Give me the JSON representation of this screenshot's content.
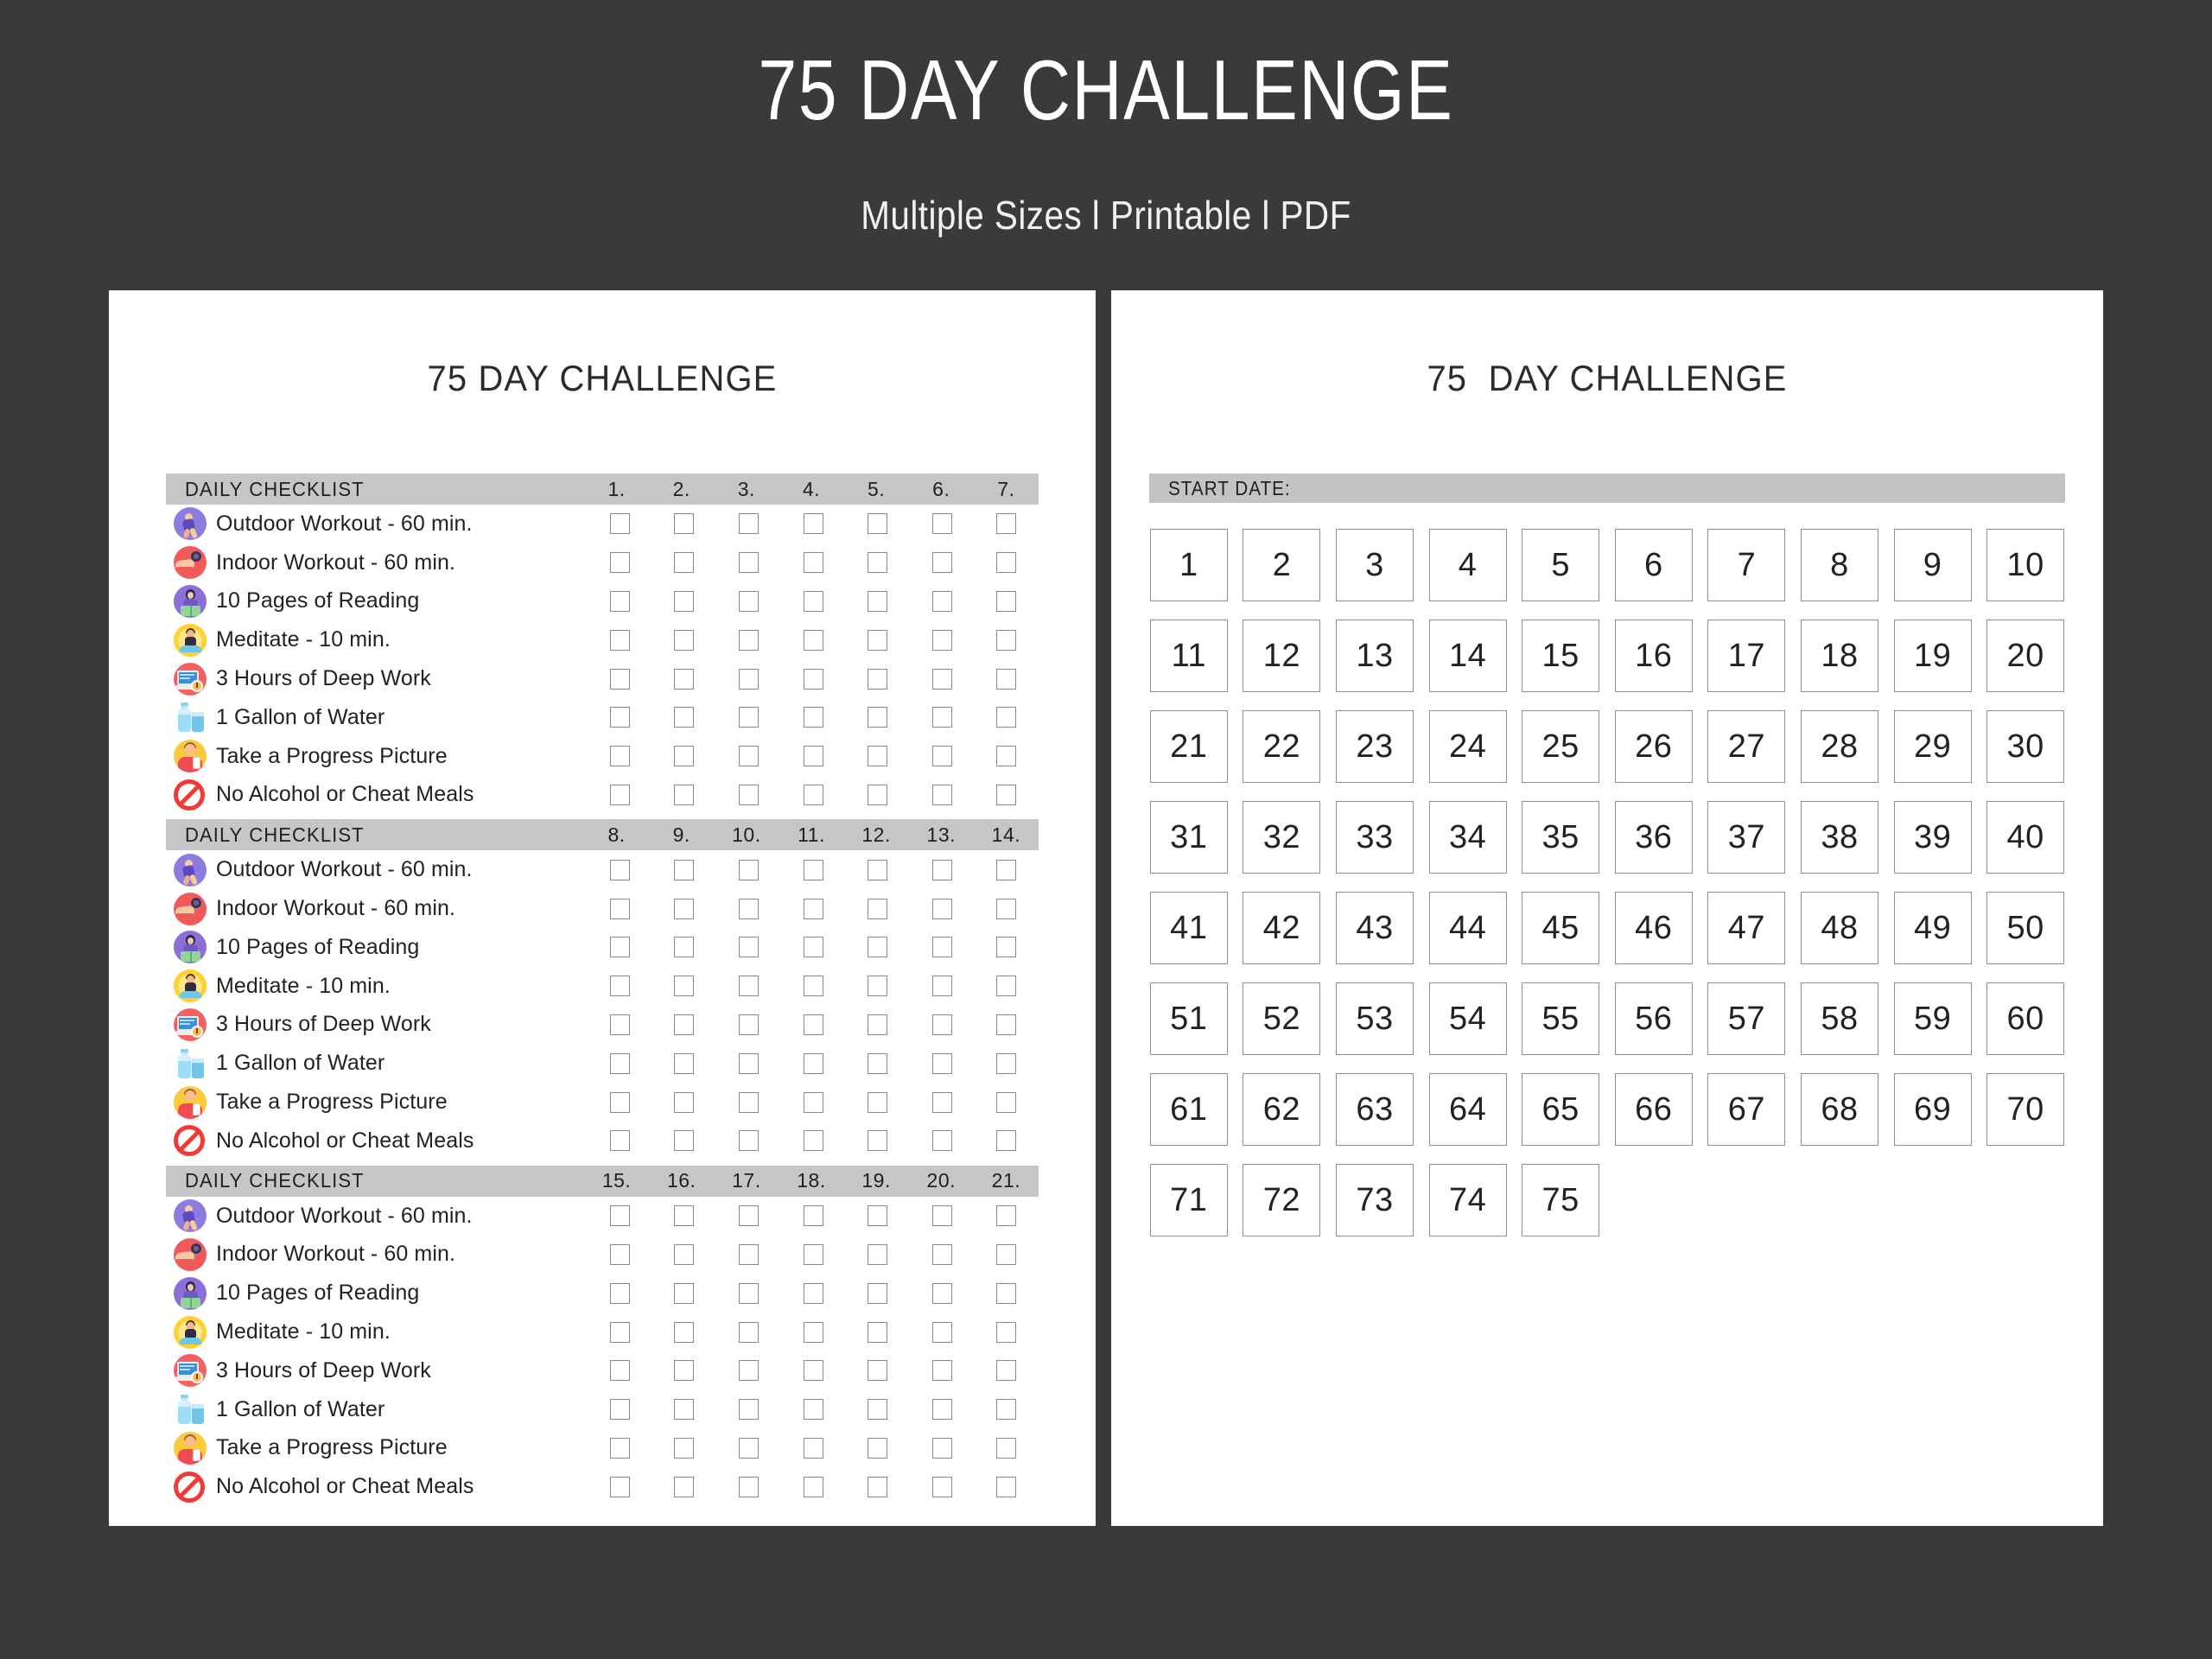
{
  "banner": {
    "title": "75 DAY CHALLENGE",
    "subtitle": "Multiple Sizes l Printable l PDF"
  },
  "colors": {
    "background": "#3a3a3a",
    "card": "#ffffff",
    "header_bar": "#c6c6c6",
    "box_border": "#8e8e8e",
    "text": "#222222"
  },
  "left_sheet": {
    "title": "75 DAY CHALLENGE",
    "block_label": "DAILY CHECKLIST",
    "tasks": [
      {
        "label": "Outdoor Workout - 60 min.",
        "icon": "running-icon"
      },
      {
        "label": "Indoor Workout - 60 min.",
        "icon": "dumbbell-icon"
      },
      {
        "label": "10 Pages of Reading",
        "icon": "reading-icon"
      },
      {
        "label": "Meditate - 10 min.",
        "icon": "meditation-icon"
      },
      {
        "label": "3 Hours of Deep Work",
        "icon": "laptop-clock-icon"
      },
      {
        "label": "1 Gallon of Water",
        "icon": "water-bottle-icon"
      },
      {
        "label": "Take a Progress Picture",
        "icon": "selfie-icon"
      },
      {
        "label": "No Alcohol or Cheat Meals",
        "icon": "prohibition-icon"
      }
    ],
    "blocks": [
      {
        "day_numbers": [
          "1.",
          "2.",
          "3.",
          "4.",
          "5.",
          "6.",
          "7."
        ]
      },
      {
        "day_numbers": [
          "8.",
          "9.",
          "10.",
          "11.",
          "12.",
          "13.",
          "14."
        ]
      },
      {
        "day_numbers": [
          "15.",
          "16.",
          "17.",
          "18.",
          "19.",
          "20.",
          "21."
        ]
      }
    ]
  },
  "right_sheet": {
    "title": "75  DAY CHALLENGE",
    "start_date_label": "START DATE:",
    "start_date_value": "",
    "days": [
      "1",
      "2",
      "3",
      "4",
      "5",
      "6",
      "7",
      "8",
      "9",
      "10",
      "11",
      "12",
      "13",
      "14",
      "15",
      "16",
      "17",
      "18",
      "19",
      "20",
      "21",
      "22",
      "23",
      "24",
      "25",
      "26",
      "27",
      "28",
      "29",
      "30",
      "31",
      "32",
      "33",
      "34",
      "35",
      "36",
      "37",
      "38",
      "39",
      "40",
      "41",
      "42",
      "43",
      "44",
      "45",
      "46",
      "47",
      "48",
      "49",
      "50",
      "51",
      "52",
      "53",
      "54",
      "55",
      "56",
      "57",
      "58",
      "59",
      "60",
      "61",
      "62",
      "63",
      "64",
      "65",
      "66",
      "67",
      "68",
      "69",
      "70",
      "71",
      "72",
      "73",
      "74",
      "75"
    ]
  }
}
